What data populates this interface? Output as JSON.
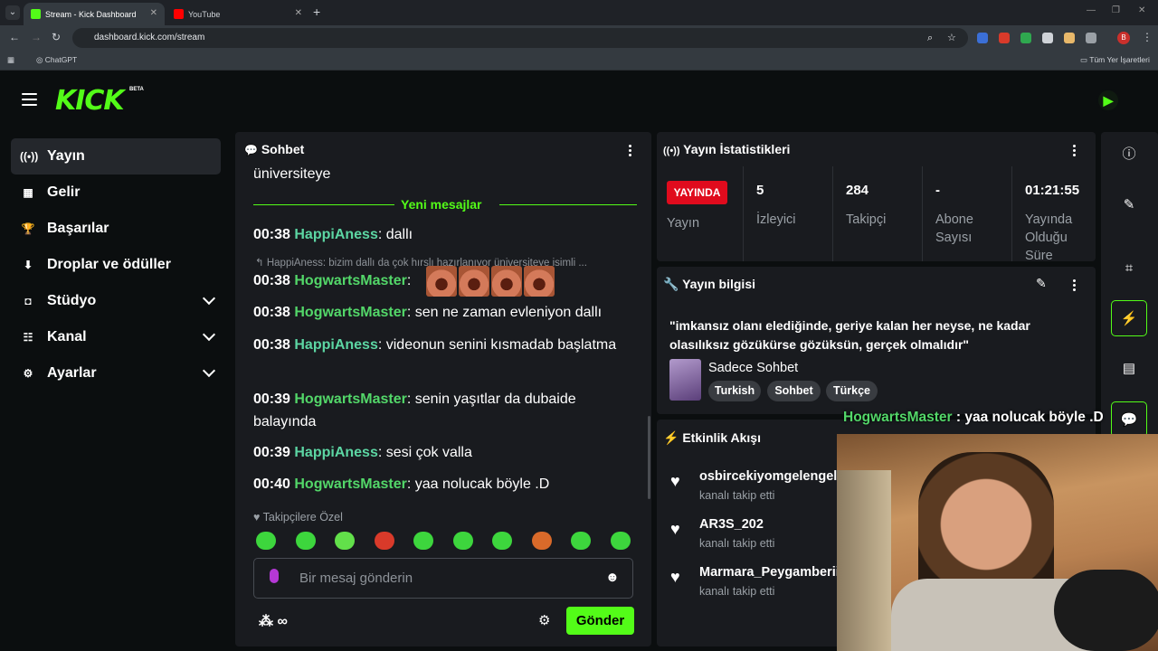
{
  "browser": {
    "tabs": [
      {
        "title": "Stream - Kick Dashboard",
        "favicon_color": "#53fc18"
      },
      {
        "title": "YouTube",
        "favicon_color": "#ff0000"
      }
    ],
    "url": "dashboard.kick.com/stream",
    "bookmarks": {
      "item": "ChatGPT",
      "all": "Tüm Yer İşaretleri"
    },
    "profile_initial": "B"
  },
  "header": {
    "logo": "KICK",
    "badge": "BETA"
  },
  "sidebar": {
    "items": [
      {
        "label": "Yayın",
        "icon": "broadcast-icon",
        "glyph": "((•))",
        "active": true,
        "expandable": false
      },
      {
        "label": "Gelir",
        "icon": "revenue-icon",
        "glyph": "▦",
        "active": false,
        "expandable": false
      },
      {
        "label": "Başarılar",
        "icon": "trophy-icon",
        "glyph": "🏆",
        "active": false,
        "expandable": false
      },
      {
        "label": "Droplar ve ödüller",
        "icon": "gift-icon",
        "glyph": "⬇",
        "active": false,
        "expandable": false
      },
      {
        "label": "Stüdyo",
        "icon": "studio-icon",
        "glyph": "◘",
        "active": false,
        "expandable": true
      },
      {
        "label": "Kanal",
        "icon": "channel-icon",
        "glyph": "☷",
        "active": false,
        "expandable": true
      },
      {
        "label": "Ayarlar",
        "icon": "settings-icon",
        "glyph": "⚙",
        "active": false,
        "expandable": true
      }
    ]
  },
  "chat": {
    "title": "Sohbet",
    "prev_line": "üniversiteye",
    "new_messages_label": "Yeni mesajlar",
    "messages": [
      {
        "time": "00:38",
        "user": "HappiAness",
        "text": "dallı",
        "color": "#5cd6a3"
      },
      {
        "time": "00:38",
        "user": "HogwartsMaster",
        "text": "",
        "color": "#53d769",
        "emotes": 4
      },
      {
        "time": "00:38",
        "user": "HogwartsMaster",
        "text": "sen ne zaman evleniyon dallı",
        "color": "#53d769"
      },
      {
        "time": "00:38",
        "user": "HappiAness",
        "text": "videonun senini kısmadab başlatma",
        "color": "#5cd6a3"
      },
      {
        "time": "00:39",
        "user": "HogwartsMaster",
        "text": "senin yaşıtlar da dubaide balayında",
        "color": "#53d769"
      },
      {
        "time": "00:39",
        "user": "HappiAness",
        "text": "sesi çok valla",
        "color": "#5cd6a3"
      },
      {
        "time": "00:40",
        "user": "HogwartsMaster",
        "text": "yaa nolucak böyle .D",
        "color": "#53d769"
      }
    ],
    "reply_preview": "HappiAness: bizim dallı da çok hırslı hazırlanıyor üniversiteye isimli ...",
    "followers_only_label": "Takipçilere Özel",
    "input_placeholder": "Bir mesaj gönderin",
    "send_label": "Gönder"
  },
  "stats": {
    "title": "Yayın İstatistikleri",
    "live_badge": "YAYINDA",
    "live_label": "Yayın",
    "items": [
      {
        "value": "5",
        "label": "İzleyici"
      },
      {
        "value": "284",
        "label": "Takipçi"
      },
      {
        "value": "-",
        "label": "Abone Sayısı"
      },
      {
        "value": "01:21:55",
        "label": "Yayında Olduğu Süre"
      }
    ]
  },
  "stream_info": {
    "title": "Yayın bilgisi",
    "stream_title": "\"imkansız olanı elediğinde, geriye kalan her neyse, ne kadar olasılıksız gözükürse gözüksün, gerçek olmalıdır\"",
    "category": "Sadece Sohbet",
    "tags": [
      "Turkish",
      "Sohbet",
      "Türkçe"
    ]
  },
  "activity": {
    "title": "Etkinlik Akışı",
    "items": [
      {
        "user": "osbircekiyomgelengels",
        "action": "kanalı takip etti"
      },
      {
        "user": "AR3S_202",
        "action": "kanalı takip etti"
      },
      {
        "user": "Marmara_Peygamberii",
        "action": "kanalı takip etti"
      }
    ]
  },
  "overlay": {
    "user": "HogwartsMaster",
    "text": ": yaa nolucak böyle .D"
  },
  "colors": {
    "accent": "#53fc18",
    "live": "#e00b1d",
    "panel": "#191b1f",
    "bg": "#0b0e0f"
  }
}
